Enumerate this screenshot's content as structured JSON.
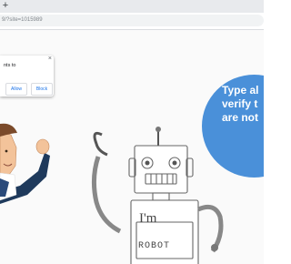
{
  "browser": {
    "new_tab_label": "+",
    "url": "9/?site=1015989"
  },
  "permission_prompt": {
    "message": "nts to",
    "close_label": "×",
    "allow_label": "Allow",
    "block_label": "Block"
  },
  "hero": {
    "lines": [
      "Type al",
      "verify t",
      "are not"
    ],
    "accent_color": "#4a90d9"
  },
  "robot": {
    "badge_text": "I'm",
    "chest_text": "ROBOT"
  }
}
